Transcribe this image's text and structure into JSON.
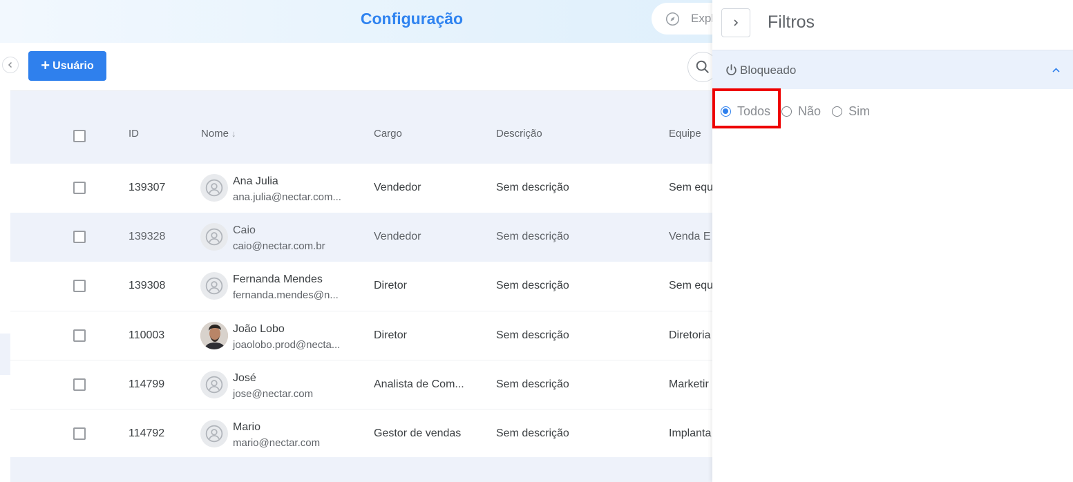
{
  "header": {
    "title": "Configuração",
    "explore_label": "Expl"
  },
  "toolbar": {
    "add_user_label": "Usuário",
    "add_user_icon": "plus-icon",
    "search_icon": "search-icon"
  },
  "table": {
    "columns": {
      "id": "ID",
      "name": "Nome",
      "cargo": "Cargo",
      "descricao": "Descrição",
      "equipe": "Equipe"
    },
    "rows": [
      {
        "id": "139307",
        "name": "Ana Julia",
        "email": "ana.julia@nectar.com...",
        "cargo": "Vendedor",
        "descricao": "Sem descrição",
        "equipe": "Sem equ",
        "avatar": "default"
      },
      {
        "id": "139328",
        "name": "Caio",
        "email": "caio@nectar.com.br",
        "cargo": "Vendedor",
        "descricao": "Sem descrição",
        "equipe": "Venda E",
        "avatar": "default"
      },
      {
        "id": "139308",
        "name": "Fernanda Mendes",
        "email": "fernanda.mendes@n...",
        "cargo": "Diretor",
        "descricao": "Sem descrição",
        "equipe": "Sem equ",
        "avatar": "default"
      },
      {
        "id": "110003",
        "name": "João Lobo",
        "email": "joaolobo.prod@necta...",
        "cargo": "Diretor",
        "descricao": "Sem descrição",
        "equipe": "Diretoria",
        "avatar": "photo"
      },
      {
        "id": "114799",
        "name": "José",
        "email": "jose@nectar.com",
        "cargo": "Analista de Com...",
        "descricao": "Sem descrição",
        "equipe": "Marketir",
        "avatar": "default"
      },
      {
        "id": "114792",
        "name": "Mario",
        "email": "mario@nectar.com",
        "cargo": "Gestor de vendas",
        "descricao": "Sem descrição",
        "equipe": "Implanta",
        "avatar": "default"
      }
    ]
  },
  "filters": {
    "title": "Filtros",
    "section": {
      "label": "Bloqueado",
      "options": [
        "Todos",
        "Não",
        "Sim"
      ],
      "selected": "Todos"
    }
  },
  "colors": {
    "accent": "#2f80ed",
    "title": "#2f83f0",
    "highlight": "#ee0000",
    "row_alt": "#eef2fa"
  }
}
